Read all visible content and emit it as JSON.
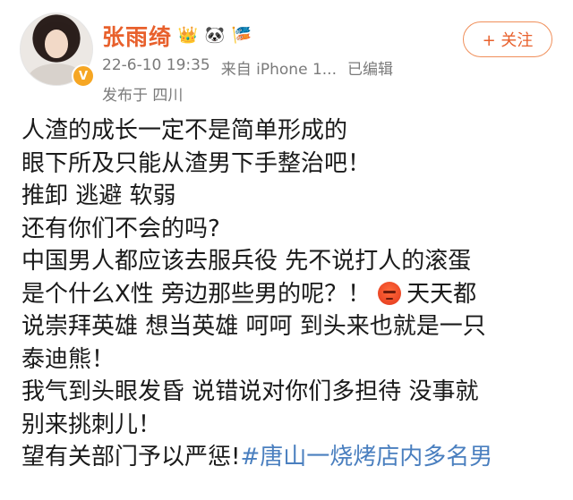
{
  "post": {
    "username": "张雨绮",
    "badges": [
      "crown-badge-icon",
      "panda-badge-icon",
      "fan-badge-icon"
    ],
    "time": "22-6-10 19:35",
    "source": "来自 iPhone 1...",
    "edited": "已编辑",
    "location": "发布于 四川",
    "follow_label": "+ 关注",
    "verified_icon": "verified-badge-icon",
    "colors": {
      "name": "#e8602c",
      "hashtag": "#4a7fbf",
      "meta": "#7a7a7a"
    },
    "lines": [
      "人渣的成长一定不是简单形成的",
      "眼下所及只能从渣男下手整治吧！",
      "推卸 逃避 软弱",
      "还有你们不会的吗?",
      "中国男人都应该去服兵役 先不说打人的滚蛋",
      "是个什么X性 旁边那些男的呢？！",
      "天天都",
      "说崇拜英雄 想当英雄 呵呵 到头来也就是一只",
      "泰迪熊！",
      "我气到头眼发昏 说错说对你们多担待 没事就",
      "别来挑刺儿！",
      "望有关部门予以严惩!",
      "#唐山一烧烤店内多名男"
    ],
    "emoji": "angry-face-icon"
  }
}
